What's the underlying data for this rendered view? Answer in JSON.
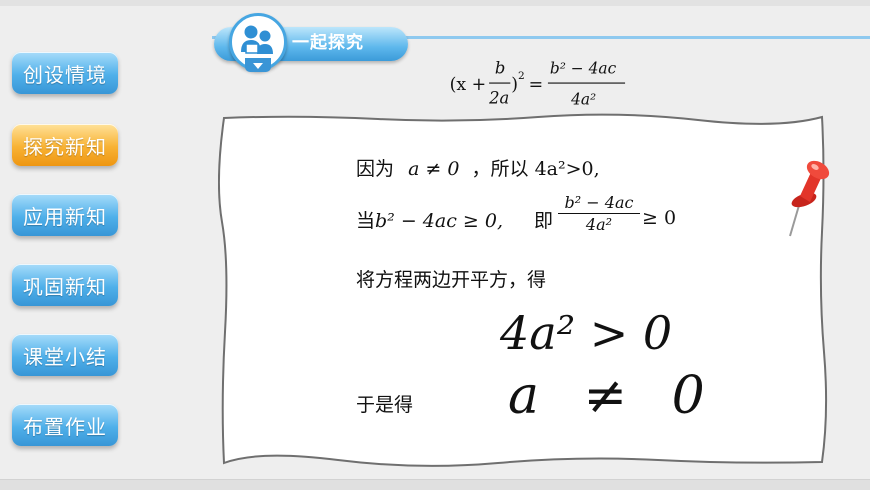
{
  "nav": {
    "items": [
      {
        "label": "创设情境",
        "active": false
      },
      {
        "label": "探究新知",
        "active": true
      },
      {
        "label": "应用新知",
        "active": false
      },
      {
        "label": "巩固新知",
        "active": false
      },
      {
        "label": "课堂小结",
        "active": false
      },
      {
        "label": "布置作业",
        "active": false
      }
    ]
  },
  "header": {
    "title": "一起探究"
  },
  "formula": {
    "left_open": "(x +",
    "frac_b_num": "b",
    "frac_b_den": "2a",
    "left_close": ")",
    "left_exp": "2",
    "equals": "=",
    "rhs_num": "b² − 4ac",
    "rhs_den": "4a²"
  },
  "content": {
    "line1_pre": "因为",
    "line1_math": "a ≠ 0",
    "line1_mid": "，所以",
    "line1_math2": "4a²>0,",
    "line2_pre": "当",
    "line2_math": "b² − 4ac ≥ 0,",
    "line2_mid": "即",
    "line2_frac_num": "b² − 4ac",
    "line2_frac_den": "4a²",
    "line2_tail": "≥ 0",
    "line3": "将方程两边开平方，得",
    "big1": "4a² > 0",
    "line5_pre": "于是得",
    "big2": "a ≠ 0"
  },
  "colors": {
    "nav_blue": "#4fb0ea",
    "nav_orange": "#f8b234",
    "header_blue": "#3b9bd9",
    "pin_red": "#e2352a"
  },
  "icons": [
    "teacher-student-icon",
    "pushpin-icon"
  ]
}
